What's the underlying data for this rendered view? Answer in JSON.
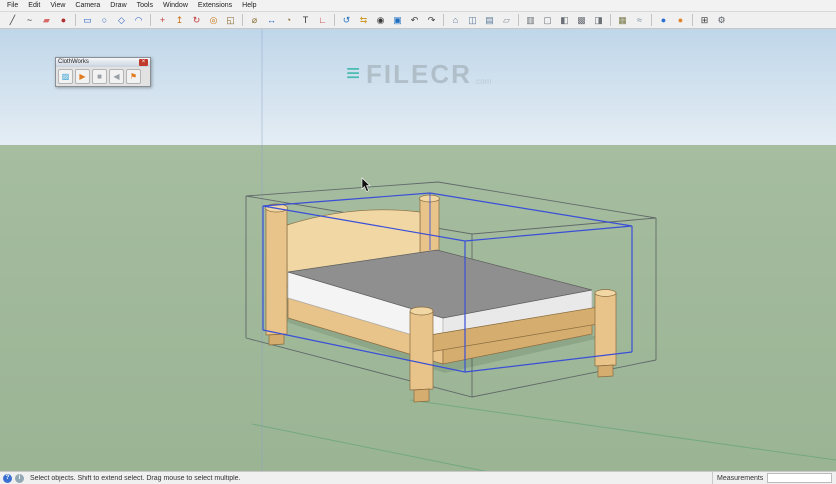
{
  "menu": {
    "items": [
      "File",
      "Edit",
      "View",
      "Camera",
      "Draw",
      "Tools",
      "Window",
      "Extensions",
      "Help"
    ]
  },
  "toolbar": {
    "icons": [
      {
        "name": "line-tool-icon",
        "glyph": "╱",
        "color": "#3a3a3a"
      },
      {
        "name": "freehand-tool-icon",
        "glyph": "~",
        "color": "#3a3a3a"
      },
      {
        "name": "eraser-tool-icon",
        "glyph": "▰",
        "color": "#d86a6a"
      },
      {
        "name": "paint-bucket-icon",
        "glyph": "●",
        "color": "#b03030"
      },
      {
        "separator": true
      },
      {
        "name": "rectangle-tool-icon",
        "glyph": "▭",
        "color": "#2a5fc4"
      },
      {
        "name": "circle-tool-icon",
        "glyph": "○",
        "color": "#2a5fc4"
      },
      {
        "name": "polygon-tool-icon",
        "glyph": "◇",
        "color": "#2a5fc4"
      },
      {
        "name": "arc-tool-icon",
        "glyph": "◠",
        "color": "#2a5fc4"
      },
      {
        "separator": true
      },
      {
        "name": "move-tool-icon",
        "glyph": "+",
        "color": "#c23a3a"
      },
      {
        "name": "push-pull-tool-icon",
        "glyph": "↥",
        "color": "#c9700f"
      },
      {
        "name": "rotate-tool-icon",
        "glyph": "↻",
        "color": "#c23a3a"
      },
      {
        "name": "offset-tool-icon",
        "glyph": "◎",
        "color": "#c9700f"
      },
      {
        "name": "scale-tool-icon",
        "glyph": "◱",
        "color": "#8a6a2f"
      },
      {
        "separator": true
      },
      {
        "name": "tape-measure-icon",
        "glyph": "⌀",
        "color": "#8a6a2f"
      },
      {
        "name": "dimension-tool-icon",
        "glyph": "↔",
        "color": "#2a5fc4"
      },
      {
        "name": "protractor-tool-icon",
        "glyph": "◔",
        "color": "#8a6a2f"
      },
      {
        "name": "text-tool-icon",
        "glyph": "T",
        "color": "#3a3a3a"
      },
      {
        "name": "axes-tool-icon",
        "glyph": "∟",
        "color": "#c23a3a"
      },
      {
        "separator": true
      },
      {
        "name": "orbit-tool-icon",
        "glyph": "↺",
        "color": "#1f6fc0"
      },
      {
        "name": "pan-tool-icon",
        "glyph": "⇆",
        "color": "#d09a2a"
      },
      {
        "name": "zoom-tool-icon",
        "glyph": "◉",
        "color": "#3a3a3a"
      },
      {
        "name": "zoom-extents-icon",
        "glyph": "▣",
        "color": "#1f6fc0"
      },
      {
        "name": "previous-view-icon",
        "glyph": "↶",
        "color": "#3a3a3a"
      },
      {
        "name": "next-view-icon",
        "glyph": "↷",
        "color": "#3a3a3a"
      },
      {
        "separator": true
      },
      {
        "name": "front-view-icon",
        "glyph": "⌂",
        "color": "#5a7a9a"
      },
      {
        "name": "iso-view-icon",
        "glyph": "◫",
        "color": "#5a7a9a"
      },
      {
        "name": "top-view-icon",
        "glyph": "▤",
        "color": "#5a7a9a"
      },
      {
        "name": "section-plane-icon",
        "glyph": "▱",
        "color": "#8a8f96"
      },
      {
        "separator": true
      },
      {
        "name": "wireframe-style-icon",
        "glyph": "▥",
        "color": "#6a6f76"
      },
      {
        "name": "hidden-line-style-icon",
        "glyph": "▢",
        "color": "#6a6f76"
      },
      {
        "name": "shaded-style-icon",
        "glyph": "◧",
        "color": "#6a6f76"
      },
      {
        "name": "textured-style-icon",
        "glyph": "▩",
        "color": "#6a6f76"
      },
      {
        "name": "monochrome-style-icon",
        "glyph": "◨",
        "color": "#6a6f76"
      },
      {
        "separator": true
      },
      {
        "name": "shadows-toggle-icon",
        "glyph": "▦",
        "color": "#7a7a4a"
      },
      {
        "name": "fog-toggle-icon",
        "glyph": "≈",
        "color": "#7a8a9a"
      },
      {
        "separator": true
      },
      {
        "name": "cloth-sphere-blue-icon",
        "glyph": "●",
        "color": "#2b6fd4"
      },
      {
        "name": "cloth-sphere-orange-icon",
        "glyph": "●",
        "color": "#e0832b"
      },
      {
        "separator": true
      },
      {
        "name": "zoom-region-icon",
        "glyph": "⊞",
        "color": "#3a3a3a"
      },
      {
        "name": "preferences-gear-icon",
        "glyph": "⚙",
        "color": "#5a5f66"
      }
    ]
  },
  "clothworks": {
    "title": "ClothWorks",
    "close_glyph": "×",
    "buttons": [
      {
        "name": "cloth-tool-button",
        "glyph": "▨",
        "color": "#2e9fd4"
      },
      {
        "name": "run-simulation-button",
        "glyph": "▶",
        "color": "#e07b1f"
      },
      {
        "name": "stop-simulation-button",
        "glyph": "■",
        "color": "#9aa0a6"
      },
      {
        "name": "step-back-button",
        "glyph": "◀",
        "color": "#9aa0a6"
      },
      {
        "name": "pin-vertices-button",
        "glyph": "⚑",
        "color": "#e07b1f"
      }
    ]
  },
  "watermark": {
    "icon_glyph": "≡",
    "text": "FILECR",
    "suffix": ".com"
  },
  "status": {
    "icons": [
      {
        "name": "help-status-icon",
        "glyph": "?",
        "color": "#3a6fd0"
      },
      {
        "name": "info-status-icon",
        "glyph": "i",
        "color": "#93a8b5"
      }
    ],
    "message": "Select objects. Shift to extend select. Drag mouse to select multiple.",
    "measurements_label": "Measurements",
    "measurements_value": ""
  },
  "colors": {
    "selection_blue": "#3a4fd8",
    "bounds_gray": "#565b61",
    "wood": "#e8c48a",
    "wood_light": "#f0d7a4",
    "wood_dark": "#d5ae6f",
    "wood_edge": "#8a6b3f",
    "mattress_top": "#8f8f8f",
    "mattress_front": "#f4f4f4",
    "mattress_side": "#e9e9e9",
    "sky_top": "#bfd6e9",
    "sky_bottom": "#e4edf4",
    "ground_top": "#a6bd9f",
    "ground_bottom": "#9ab494",
    "axis_green": "#4f9d6b",
    "axis_blue": "#8aa0c8"
  }
}
